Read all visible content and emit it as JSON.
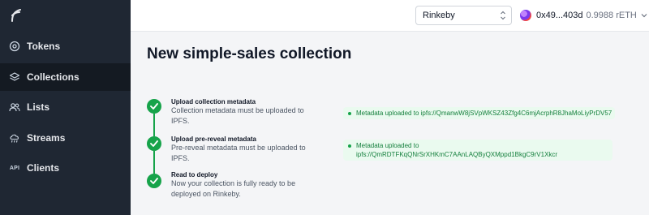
{
  "sidebar": {
    "items": [
      {
        "label": "Tokens",
        "icon": "token-icon"
      },
      {
        "label": "Collections",
        "icon": "stack-icon",
        "active": true
      },
      {
        "label": "Lists",
        "icon": "users-icon"
      },
      {
        "label": "Streams",
        "icon": "cloud-rain-icon"
      },
      {
        "label": "Clients",
        "icon": "api-icon",
        "icon_text": "API"
      }
    ]
  },
  "topbar": {
    "network": "Rinkeby",
    "account_address": "0x49...403d",
    "balance": "0.9988 rETH"
  },
  "main": {
    "title": "New simple-sales collection",
    "steps": [
      {
        "title": "Upload collection metadata",
        "description": "Collection metadata must be uploaded to IPFS.",
        "status": "Metadata uploaded to ipfs://QmanwW8jSVpWKSZ43Zfg4C6mjAcrphR8JhaMoLiyPrDV57"
      },
      {
        "title": "Upload pre-reveal metadata",
        "description": "Pre-reveal metadata must be uploaded to IPFS.",
        "status": "Metadata uploaded to ipfs://QmRDTFKqQNrSrXHKmC7AAnLAQByQXMppd1BkgC9rV1Xkcr"
      },
      {
        "title": "Read to deploy",
        "description": "Now your collection is fully ready to be deployed on Rinkeby."
      }
    ]
  },
  "colors": {
    "sidebar_bg": "#1f2733",
    "sidebar_active_bg": "#141a22",
    "success": "#16a34a",
    "chip_bg": "#eafaef"
  }
}
